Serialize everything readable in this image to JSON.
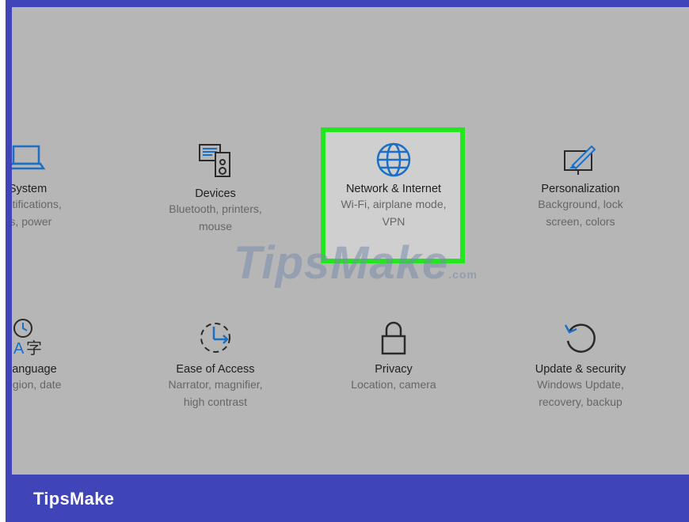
{
  "colors": {
    "frame": "#3f44b8",
    "panel": "#b6b6b6",
    "highlight": "#22e61e",
    "icon": "#1b6fc4"
  },
  "footer": {
    "brand": "TipsMake"
  },
  "watermark": {
    "text": "TipsMake",
    "suffix": ".com"
  },
  "tiles": [
    {
      "id": "system",
      "icon": "laptop-icon",
      "title": "System",
      "line1": ", notifications,",
      "line2": "ps, power"
    },
    {
      "id": "devices",
      "icon": "devices-icon",
      "title": "Devices",
      "line1": "Bluetooth, printers,",
      "line2": "mouse"
    },
    {
      "id": "network",
      "icon": "globe-icon",
      "title": "Network & Internet",
      "line1": "Wi-Fi, airplane mode,",
      "line2": "VPN",
      "highlighted": true
    },
    {
      "id": "personalization",
      "icon": "personalization-icon",
      "title": "Personalization",
      "line1": "Background, lock",
      "line2": "screen, colors"
    },
    {
      "id": "time-language",
      "icon": "time-language-icon",
      "title": "& language",
      "line1": "i, region, date",
      "line2": ""
    },
    {
      "id": "ease-of-access",
      "icon": "ease-of-access-icon",
      "title": "Ease of Access",
      "line1": "Narrator, magnifier,",
      "line2": "high contrast"
    },
    {
      "id": "privacy",
      "icon": "lock-icon",
      "title": "Privacy",
      "line1": "Location, camera",
      "line2": ""
    },
    {
      "id": "update-security",
      "icon": "update-icon",
      "title": "Update & security",
      "line1": "Windows Update,",
      "line2": "recovery, backup"
    }
  ]
}
